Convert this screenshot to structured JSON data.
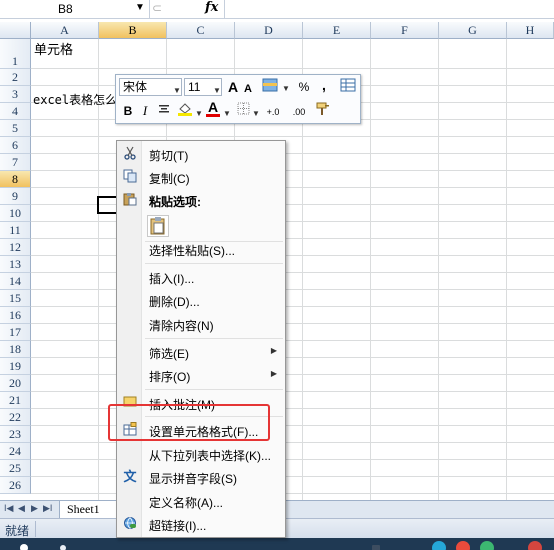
{
  "formula_bar": {
    "name_box": "B8",
    "name_arrow": "▼",
    "fx": "fx"
  },
  "grid": {
    "columns": [
      "A",
      "B",
      "C",
      "D",
      "E",
      "F",
      "G",
      "H"
    ],
    "selected_column": "B",
    "rows": [
      "1",
      "2",
      "3",
      "4",
      "5",
      "6",
      "7",
      "8",
      "9",
      "10",
      "11",
      "12",
      "13",
      "14",
      "15",
      "16",
      "17",
      "18",
      "19",
      "20",
      "21",
      "22",
      "23",
      "24",
      "25",
      "26"
    ],
    "selected_row": "8",
    "cell_a1": "单元格",
    "cell_a3": "excel表格怎么"
  },
  "mini_toolbar": {
    "font_name": "宋体",
    "font_size": "11",
    "grow_font": "A",
    "shrink_font": "A",
    "percent": "%",
    "comma": ",",
    "bold": "B",
    "italic": "I",
    "font_color_glyph": "A",
    "inc_decimal": "+.0",
    "dec_decimal": ".00"
  },
  "context_menu": {
    "cut": "剪切(T)",
    "copy": "复制(C)",
    "paste_options": "粘贴选项:",
    "paste_special": "选择性粘贴(S)...",
    "insert": "插入(I)...",
    "delete": "删除(D)...",
    "clear_contents": "清除内容(N)",
    "filter": "筛选(E)",
    "sort": "排序(O)",
    "insert_comment": "插入批注(M)",
    "format_cells": "设置单元格格式(F)...",
    "pick_from_list": "从下拉列表中选择(K)...",
    "show_phonetic": "显示拼音字段(S)",
    "define_name": "定义名称(A)...",
    "hyperlink": "超链接(I)..."
  },
  "sheet_tabs": {
    "active": "Sheet1"
  },
  "status_bar": {
    "ready": "就绪"
  },
  "colors": {
    "highlight_box": "#e53535",
    "header_selected": "#f1c15f",
    "menu_gutter": "#f0f0f0"
  }
}
